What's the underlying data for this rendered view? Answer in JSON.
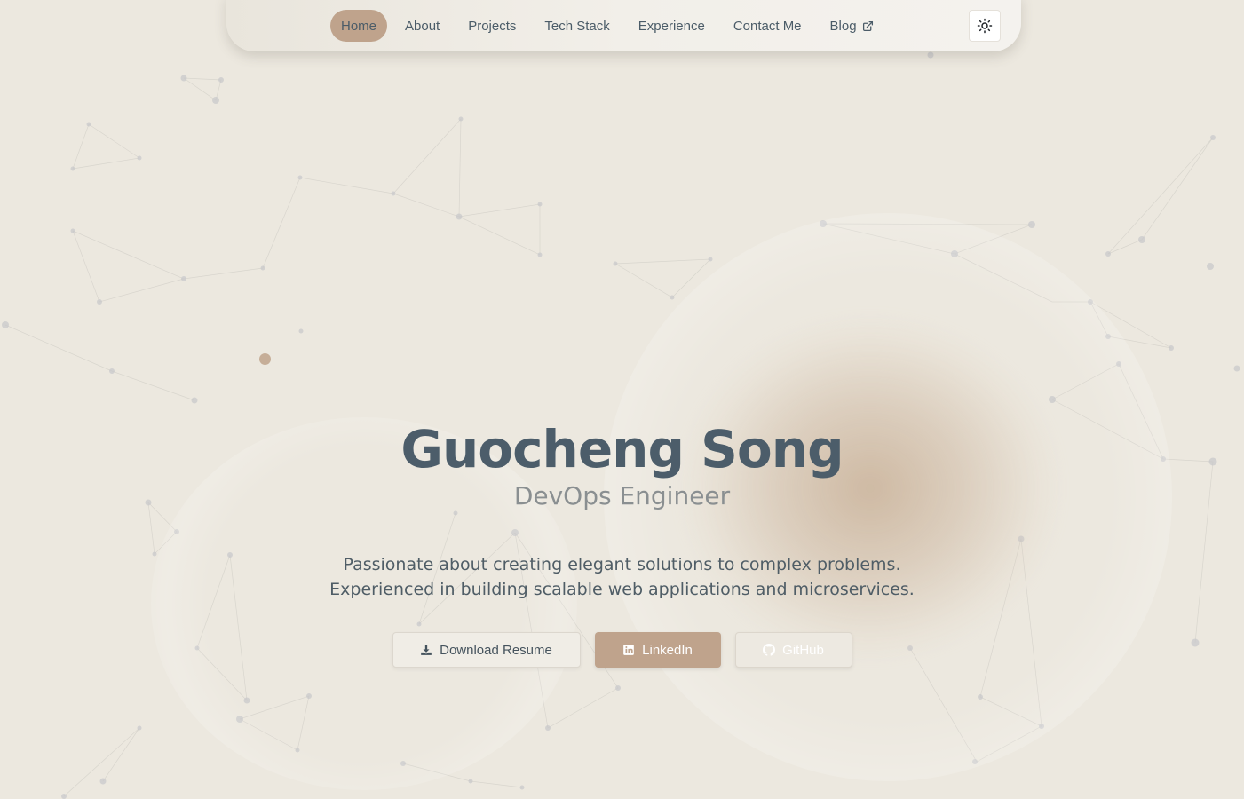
{
  "nav": {
    "items": [
      {
        "label": "Home",
        "active": true
      },
      {
        "label": "About",
        "active": false
      },
      {
        "label": "Projects",
        "active": false
      },
      {
        "label": "Tech Stack",
        "active": false
      },
      {
        "label": "Experience",
        "active": false
      },
      {
        "label": "Contact Me",
        "active": false
      },
      {
        "label": "Blog",
        "active": false,
        "icon": "external-link-icon"
      }
    ],
    "theme_toggle_icon": "sun-icon"
  },
  "hero": {
    "name": "Guocheng Song",
    "role": "DevOps Engineer",
    "description_line1": "Passionate about creating elegant solutions to complex problems.",
    "description_line2": "Experienced in building scalable web applications and microservices."
  },
  "buttons": {
    "resume": {
      "label": "Download Resume",
      "icon": "download-icon"
    },
    "linkedin": {
      "label": "LinkedIn",
      "icon": "linkedin-icon"
    },
    "github": {
      "label": "GitHub",
      "icon": "github-icon"
    }
  },
  "colors": {
    "background": "#ece8df",
    "accent": "#bfa38c",
    "text": "#4c5d6a"
  }
}
